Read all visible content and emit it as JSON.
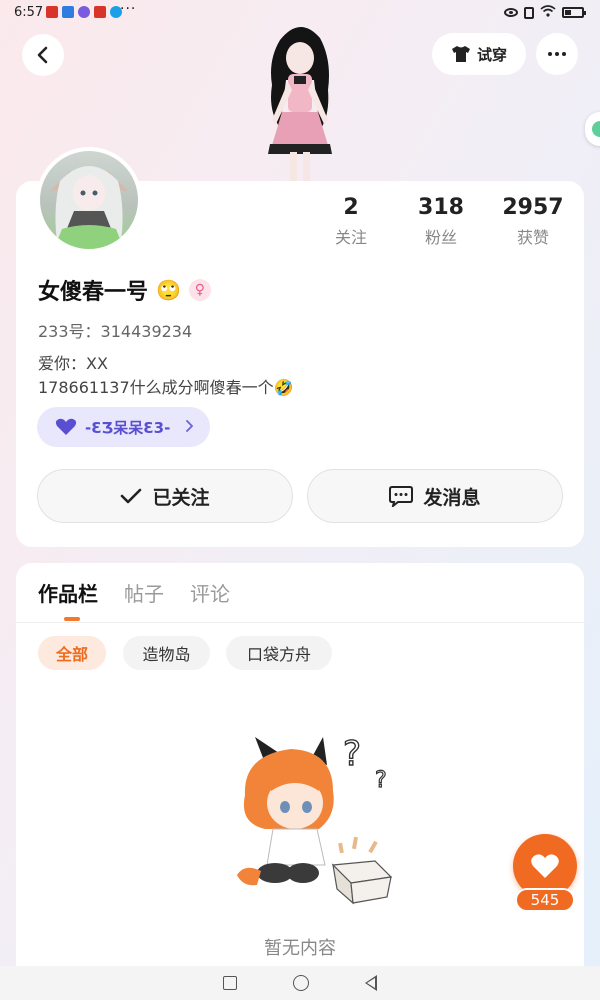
{
  "status_bar": {
    "time": "6:57",
    "more_dots": "···"
  },
  "nav": {
    "tryon_label": "试穿"
  },
  "profile": {
    "stats": [
      {
        "value": "2",
        "label": "关注"
      },
      {
        "value": "318",
        "label": "粉丝"
      },
      {
        "value": "2957",
        "label": "获赞"
      }
    ],
    "username": "女傻春一号",
    "username_emoji": "🙄",
    "gender_symbol": "♀",
    "uid": "233号：314439234",
    "bio_line1": "爱你：XX",
    "bio_line2": "178661137什么成分啊傻春一个🤣",
    "fan_badge": "-ƐӠ呆呆Ɛ3-",
    "follow_label": "已关注",
    "message_label": "发消息"
  },
  "works": {
    "tabs": [
      "作品栏",
      "帖子",
      "评论"
    ],
    "active_tab": 0,
    "filters": [
      "全部",
      "造物岛",
      "口袋方舟"
    ],
    "active_filter": 0,
    "empty_text": "暂无内容"
  },
  "like": {
    "count": "545"
  },
  "colors": {
    "accent": "#f06a22",
    "badge": "#5a4fd0",
    "card_bg": "#ffffff"
  }
}
